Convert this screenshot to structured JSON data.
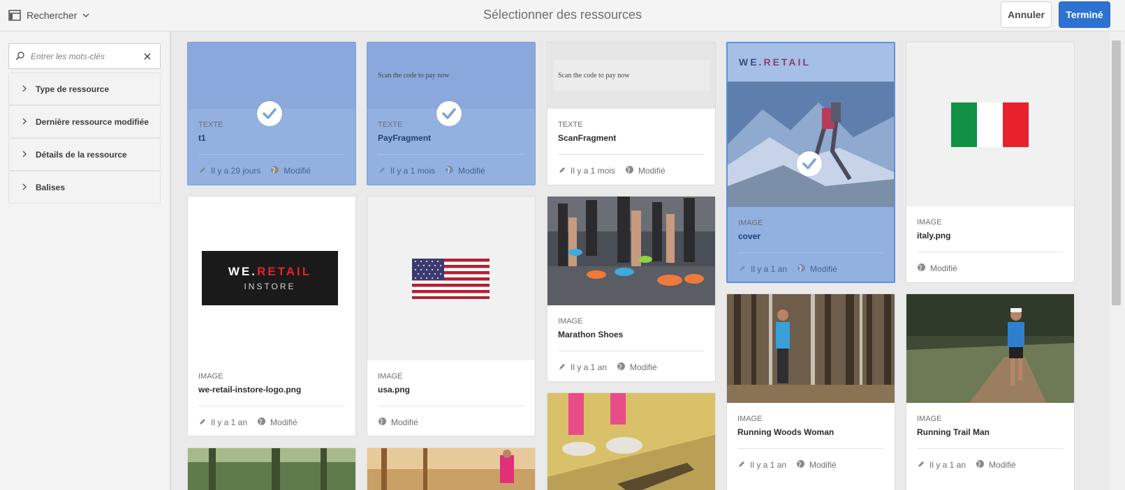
{
  "topbar": {
    "rail_label": "Rechercher",
    "title": "Sélectionner des ressources",
    "cancel_label": "Annuler",
    "done_label": "Terminé"
  },
  "sidebar": {
    "search_placeholder": "Entrer les mots-clés",
    "filters": [
      {
        "label": "Type de ressource"
      },
      {
        "label": "Dernière ressource modifiée"
      },
      {
        "label": "Détails de la ressource"
      },
      {
        "label": "Balises"
      }
    ]
  },
  "assets": [
    {
      "type": "TEXTE",
      "name": "t1",
      "age": "Il y a 29 jours",
      "status": "Modifié",
      "selected": true
    },
    {
      "type": "TEXTE",
      "name": "PayFragment",
      "age": "Il y a 1 mois",
      "status": "Modifié",
      "selected": true,
      "preview_text": "Scan the code to pay now"
    },
    {
      "type": "TEXTE",
      "name": "ScanFragment",
      "age": "Il y a 1 mois",
      "status": "Modifié",
      "selected": false,
      "preview_text": "Scan the code to pay now"
    },
    {
      "type": "IMAGE",
      "name": "cover",
      "age": "Il y a 1 an",
      "status": "Modifié",
      "selected": true,
      "logo_text_a": "WE.",
      "logo_text_b": "RETAIL"
    },
    {
      "type": "IMAGE",
      "name": "italy.png",
      "status": "Modifié",
      "selected": false
    },
    {
      "type": "IMAGE",
      "name": "we-retail-instore-logo.png",
      "age": "Il y a 1 an",
      "status": "Modifié",
      "selected": false,
      "logo_text_a": "WE.",
      "logo_text_b": "RETAIL",
      "logo_text_c": "INSTORE"
    },
    {
      "type": "IMAGE",
      "name": "usa.png",
      "status": "Modifié",
      "selected": false
    },
    {
      "type": "IMAGE",
      "name": "Marathon Shoes",
      "age": "Il y a 1 an",
      "status": "Modifié",
      "selected": false
    },
    {
      "type": "IMAGE",
      "name": "Running Woods Woman",
      "age": "Il y a 1 an",
      "status": "Modifié",
      "selected": false
    },
    {
      "type": "IMAGE",
      "name": "Running Trail Man",
      "age": "Il y a 1 an",
      "status": "Modifié",
      "selected": false
    }
  ],
  "colors": {
    "accent": "#2d72d2",
    "selected_bg": "#92b1e1",
    "logo_red": "#e2252b"
  },
  "icons": [
    "rail-icon",
    "chevron-down-icon",
    "search-icon",
    "clear-icon",
    "chevron-right-icon",
    "pencil-icon",
    "globe-icon",
    "check-icon"
  ]
}
